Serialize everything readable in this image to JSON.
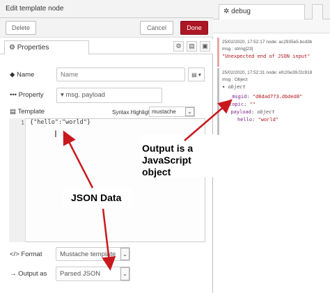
{
  "editor": {
    "title": "Edit template node",
    "delete_label": "Delete",
    "cancel_label": "Cancel",
    "done_label": "Done",
    "colors": {
      "done": "#ad1625",
      "debug_error_border": "#e6a8a8"
    },
    "tab": {
      "label": "Properties",
      "icons": [
        "gear-icon",
        "document-icon",
        "layout-icon"
      ]
    },
    "name": {
      "label": "Name",
      "placeholder": "Name"
    },
    "property": {
      "label": "Property",
      "prefix": "msg.",
      "value": "payload"
    },
    "template": {
      "label": "Template",
      "syntax_label": "Syntax Highlight:",
      "syntax_value": "mustache",
      "line_number": "1",
      "code": "{\"hello\":\"world\"}"
    },
    "format": {
      "label": "Format",
      "value": "Mustache template"
    },
    "output": {
      "label": "Output as",
      "value": "Parsed JSON"
    }
  },
  "debug": {
    "tab_label": "debug",
    "messages": [
      {
        "meta": "25/02/2020, 17:52:17   node: ac2935e5.bcd3b",
        "type": "msg : string[23]",
        "value": "\"Unexpected end of JSON input\""
      },
      {
        "meta": "25/02/2020, 17:52:31   node: efc20e39.f2c918",
        "type": "msg : Object",
        "object": "object",
        "msgid_key": "_msgid",
        "msgid_val": "\"d8dad773.dbded8\"",
        "topic_key": "topic",
        "topic_val": "\"\"",
        "payload_key": "payload",
        "payload_type": "object",
        "hello_key": "hello",
        "hello_val": "\"world\""
      }
    ]
  },
  "annotations": {
    "output_text_1": "Output is a",
    "output_text_2": "JavaScript",
    "output_text_3": "object",
    "json_text": "JSON Data",
    "arrow_color": "#c8181e"
  }
}
